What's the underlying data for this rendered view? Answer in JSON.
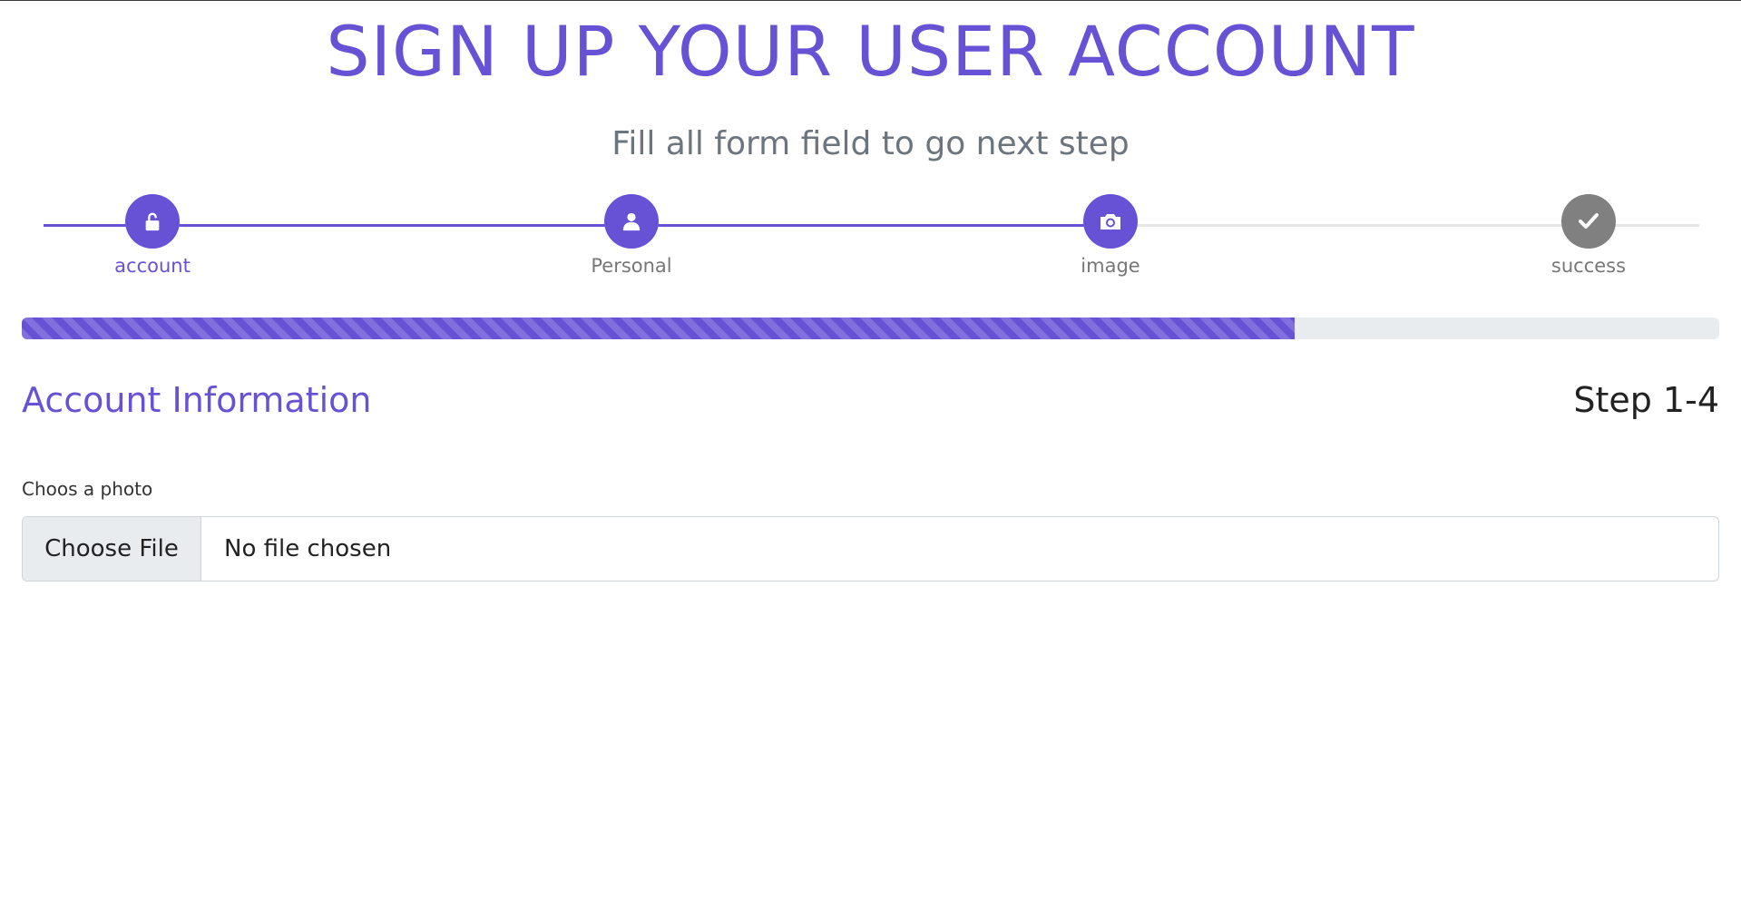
{
  "header": {
    "title": "SIGN UP YOUR USER ACCOUNT",
    "subtitle": "Fill all form field to go next step"
  },
  "stepper": {
    "steps": [
      {
        "label": "account",
        "icon": "unlock-icon",
        "state": "done"
      },
      {
        "label": "Personal",
        "icon": "user-icon",
        "state": "done"
      },
      {
        "label": "image",
        "icon": "camera-icon",
        "state": "active"
      },
      {
        "label": "success",
        "icon": "check-icon",
        "state": "pending"
      }
    ]
  },
  "progress": {
    "percent": 75
  },
  "section": {
    "title": "Account Information",
    "step_count": "Step 1-4"
  },
  "photo_field": {
    "label": "Choos a photo",
    "button_label": "Choose File",
    "status": "No file chosen"
  },
  "colors": {
    "accent": "#6752d6",
    "muted": "#6c757d",
    "pending": "#808080",
    "track": "#e6e6e6"
  }
}
